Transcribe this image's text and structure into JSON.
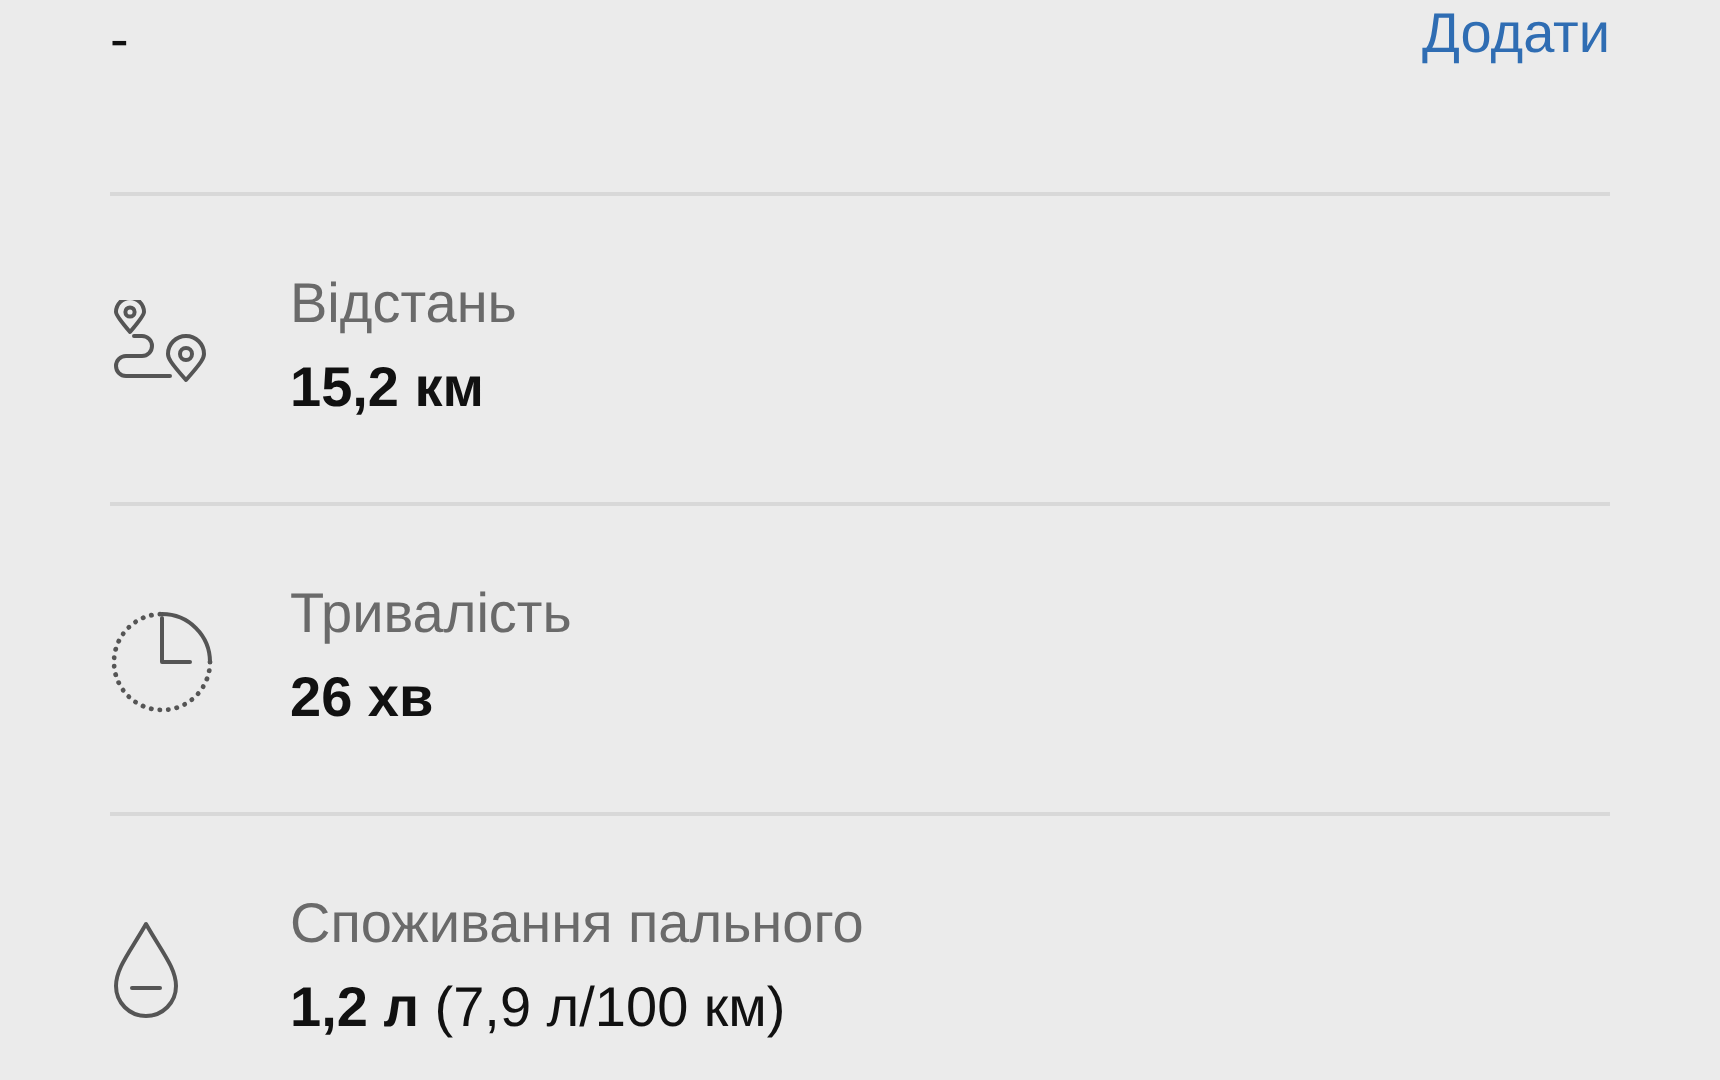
{
  "header": {
    "value": "-",
    "action": "Додати"
  },
  "stats": [
    {
      "kind": "distance",
      "label": "Відстань",
      "value": "15,2 км"
    },
    {
      "kind": "duration",
      "label": "Тривалість",
      "value": "26 хв"
    },
    {
      "kind": "fuel",
      "label": "Споживання пального",
      "value": "**1,2 л** (7,9 л/100 км)"
    }
  ]
}
